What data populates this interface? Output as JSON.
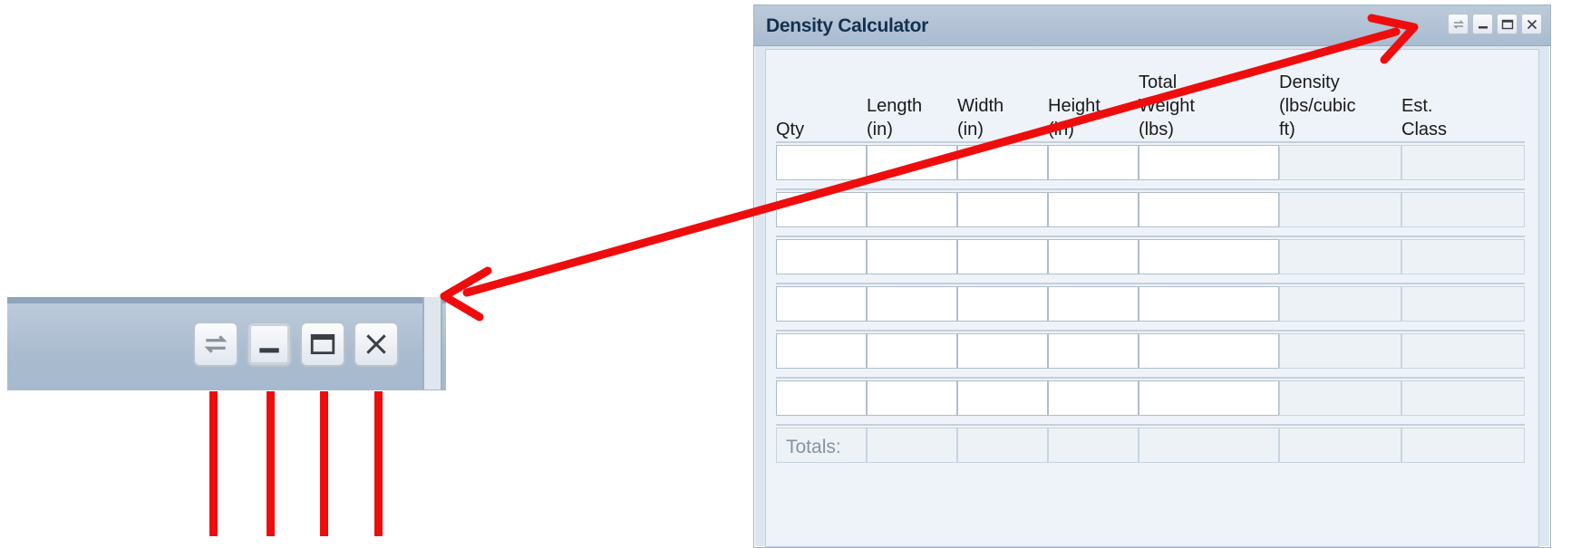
{
  "window": {
    "title": "Density Calculator",
    "tools": [
      {
        "icon": "refresh-icon"
      },
      {
        "icon": "minimize-icon"
      },
      {
        "icon": "maximize-icon"
      },
      {
        "icon": "close-icon"
      }
    ]
  },
  "table": {
    "columns": [
      {
        "label": "Qty"
      },
      {
        "label": "Length\n(in)"
      },
      {
        "label": "Width\n(in)"
      },
      {
        "label": "Height\n(in)"
      },
      {
        "label": "Total\nWeight\n(lbs)"
      },
      {
        "label": "Density\n(lbs/cubic ft)"
      },
      {
        "label": "Est.\nClass"
      }
    ],
    "input_rows": 6,
    "totals_label": "Totals:"
  },
  "colors": {
    "annotation": "#ee0d0d",
    "titlebar": "#aebfd1",
    "title_text": "#15304f"
  }
}
